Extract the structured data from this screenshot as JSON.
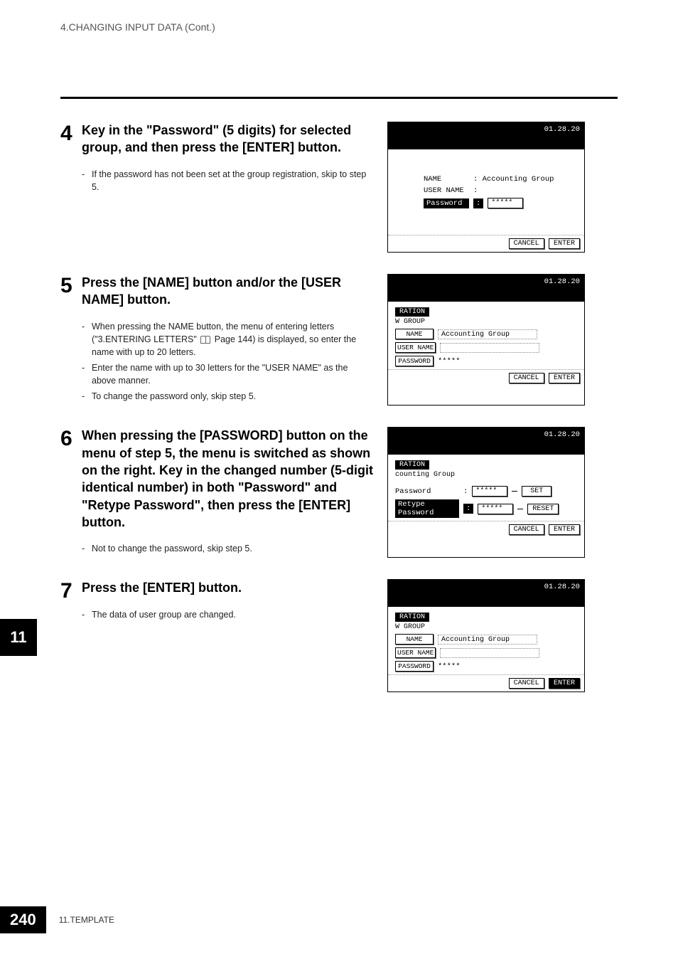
{
  "header": "4.CHANGING INPUT DATA (Cont.)",
  "sideTab": "11",
  "footer": {
    "pageNum": "240",
    "chapter": "11.TEMPLATE"
  },
  "steps": {
    "s4": {
      "num": "4",
      "title": "Key in the \"Password\" (5 digits) for selected group, and then press the [ENTER] button.",
      "bullets": [
        "If the password has not been set at the group registration, skip to step 5."
      ]
    },
    "s5": {
      "num": "5",
      "title": "Press the [NAME] button and/or the [USER NAME] button.",
      "bullets_a": "When pressing the NAME button, the menu of entering letters (\"3.ENTERING LETTERS\" ",
      "bullets_a2": " Page 144) is displayed, so enter the name with up to 20 letters.",
      "bullets_b": "Enter the name with up to 30 letters for the \"USER NAME\" as the above manner.",
      "bullets_c": "To change the password only, skip step 5."
    },
    "s6": {
      "num": "6",
      "title": "When pressing the [PASSWORD] button on the menu of step 5, the menu is switched as shown on the right. Key in the changed number (5-digit identical number) in both \"Password\" and \"Retype Password\", then press the [ENTER] button.",
      "bullets": [
        "Not to change the password, skip step 5."
      ]
    },
    "s7": {
      "num": "7",
      "title": "Press the [ENTER] button.",
      "bullets": [
        "The data of user group are changed."
      ]
    }
  },
  "screens": {
    "time": "01.28.20",
    "s4": {
      "nameLabel": "NAME",
      "nameValue": ": Accounting Group",
      "userLabel": "USER NAME",
      "userValue": ":",
      "passLabel": "Password",
      "passSep": ":",
      "passValue": "*****",
      "cancel": "CANCEL",
      "enter": "ENTER"
    },
    "s5": {
      "tab": "RATION",
      "subhead": "W GROUP",
      "nameBtn": "NAME",
      "nameVal": "Accounting Group",
      "userBtn": "USER NAME",
      "passBtn": "PASSWORD",
      "passVal": "*****",
      "cancel": "CANCEL",
      "enter": "ENTER"
    },
    "s6": {
      "tab": "RATION",
      "subhead": "counting Group",
      "passLabel": "Password",
      "passSep": ":",
      "passVal": "*****",
      "retypeLabel": "Retype Password",
      "retypeSep": ":",
      "retypeVal": "*****",
      "set": "SET",
      "reset": "RESET",
      "cancel": "CANCEL",
      "enter": "ENTER"
    },
    "s7": {
      "tab": "RATION",
      "subhead": "W GROUP",
      "nameBtn": "NAME",
      "nameVal": "Accounting Group",
      "userBtn": "USER NAME",
      "passBtn": "PASSWORD",
      "passVal": "*****",
      "cancel": "CANCEL",
      "enter": "ENTER"
    }
  }
}
